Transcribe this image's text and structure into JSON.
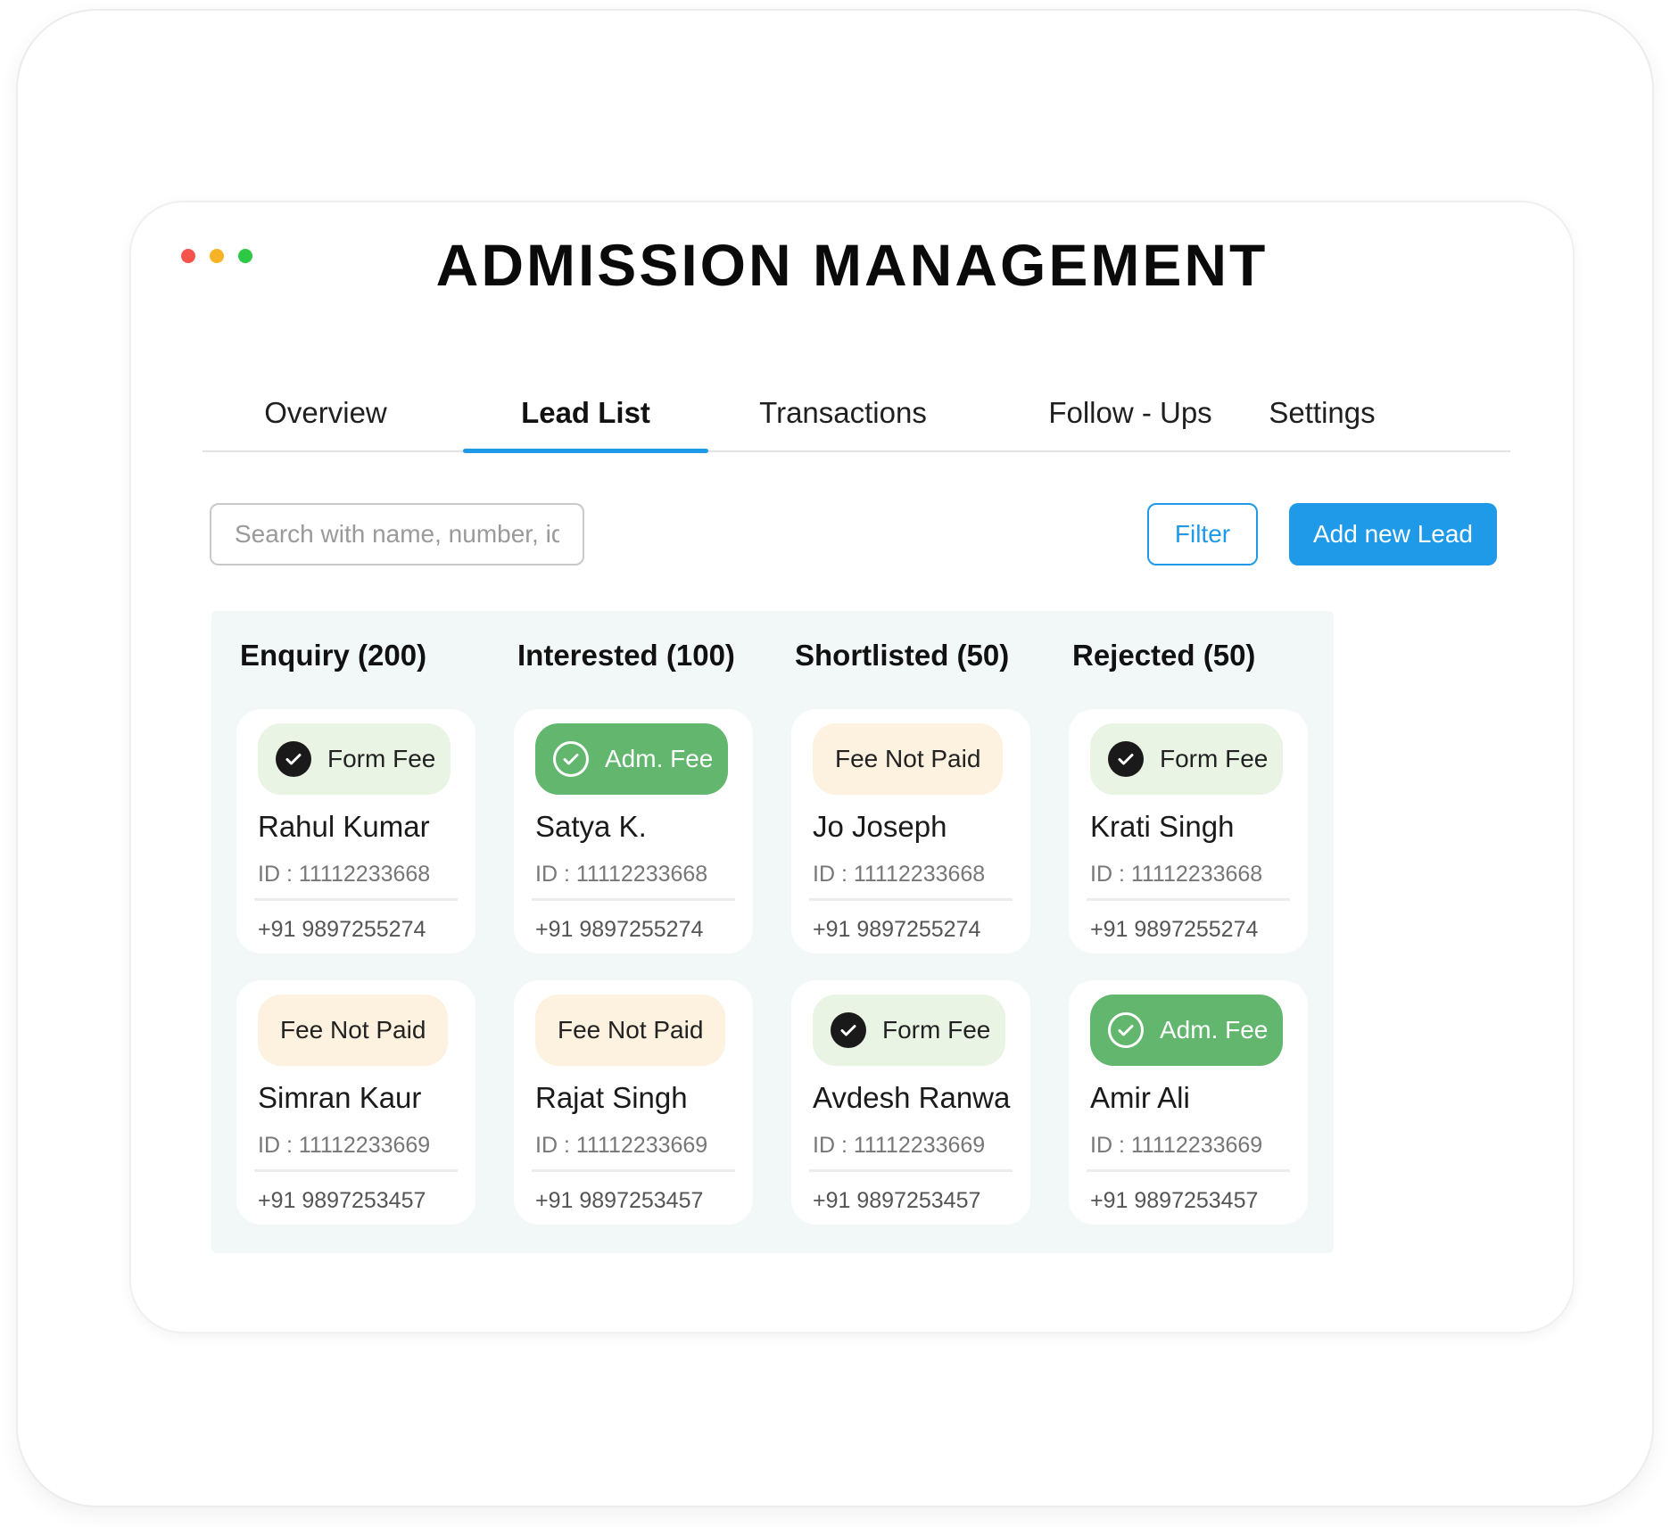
{
  "window": {
    "title": "ADMISSION MANAGEMENT",
    "dot_colors": [
      "#f5544d",
      "#f6b325",
      "#2fc845"
    ]
  },
  "tabs": [
    {
      "label": "Overview",
      "active": false
    },
    {
      "label": "Lead List",
      "active": true
    },
    {
      "label": "Transactions",
      "active": false
    },
    {
      "label": "Follow - Ups",
      "active": false
    },
    {
      "label": "Settings",
      "active": false
    }
  ],
  "toolbar": {
    "search_placeholder": "Search with name, number, id",
    "search_value": "",
    "filter_label": "Filter",
    "add_label": "Add new Lead"
  },
  "colors": {
    "accent": "#1f9ae8",
    "column_bg": "#f2f8f8",
    "badge_form_fee_bg": "#eaf4e5",
    "badge_adm_fee_bg": "#62b66e",
    "badge_not_paid_bg": "#fdf1df"
  },
  "columns": [
    {
      "title": "Enquiry (200)",
      "cards": [
        {
          "badge": "Form Fee",
          "badge_type": "form-fee",
          "badge_icon": "check-circle-icon",
          "name": "Rahul Kumar",
          "id": "ID : 11112233668",
          "phone": "+91 9897255274"
        },
        {
          "badge": "Fee Not Paid",
          "badge_type": "not-paid",
          "badge_icon": "",
          "name": "Simran Kaur",
          "id": "ID : 11112233669",
          "phone": "+91 9897253457"
        }
      ]
    },
    {
      "title": "Interested (100)",
      "cards": [
        {
          "badge": "Adm. Fee",
          "badge_type": "adm-fee",
          "badge_icon": "check-circle-icon",
          "name": "Satya K.",
          "id": "ID : 11112233668",
          "phone": "+91 9897255274"
        },
        {
          "badge": "Fee Not Paid",
          "badge_type": "not-paid",
          "badge_icon": "",
          "name": "Rajat Singh",
          "id": "ID : 11112233669",
          "phone": "+91 9897253457"
        }
      ]
    },
    {
      "title": "Shortlisted (50)",
      "cards": [
        {
          "badge": "Fee Not Paid",
          "badge_type": "not-paid",
          "badge_icon": "",
          "name": "Jo Joseph",
          "id": "ID : 11112233668",
          "phone": "+91 9897255274"
        },
        {
          "badge": "Form Fee",
          "badge_type": "form-fee",
          "badge_icon": "check-circle-icon",
          "name": "Avdesh Ranwa",
          "id": "ID : 11112233669",
          "phone": "+91 9897253457"
        }
      ]
    },
    {
      "title": "Rejected (50)",
      "cards": [
        {
          "badge": "Form Fee",
          "badge_type": "form-fee",
          "badge_icon": "check-circle-icon",
          "name": "Krati Singh",
          "id": "ID : 11112233668",
          "phone": "+91 9897255274"
        },
        {
          "badge": "Adm. Fee",
          "badge_type": "adm-fee",
          "badge_icon": "check-circle-icon",
          "name": "Amir Ali",
          "id": "ID : 11112233669",
          "phone": "+91 9897253457"
        }
      ]
    }
  ]
}
